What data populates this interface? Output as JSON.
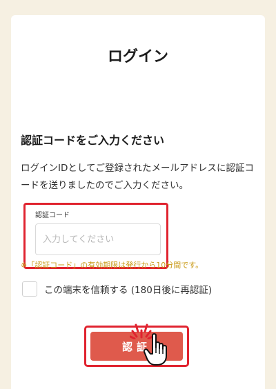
{
  "page": {
    "title": "ログイン",
    "heading": "認証コードをご入力ください",
    "description": "ログインIDとしてご登録されたメールアドレスに認証コードを送りましたのでご入力ください。"
  },
  "code_field": {
    "label": "認証コード",
    "placeholder": "入力してください",
    "value": ""
  },
  "note": "※「認証コード」の有効期限は発行から10分間です。",
  "trust_device": {
    "label": "この端末を信頼する (180日後に再認証)",
    "checked": false
  },
  "submit": {
    "label": "認証"
  },
  "colors": {
    "background": "#f6f0e2",
    "accent_button": "#df5a4c",
    "highlight_frame": "#e0232f",
    "note_text": "#c99a16"
  },
  "icons": {
    "click_burst": "click-burst-icon",
    "pointer": "hand-pointer-cursor-icon"
  }
}
